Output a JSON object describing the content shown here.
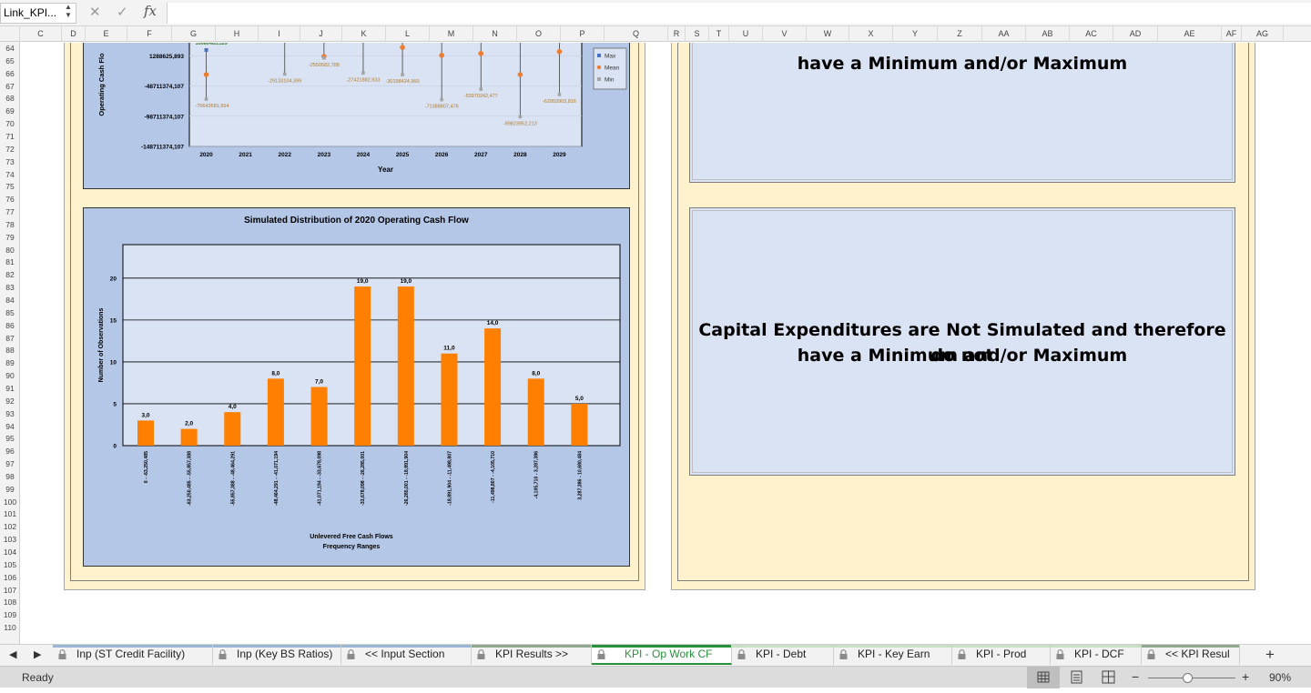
{
  "formula_bar": {
    "name_box": "Link_KPI...",
    "fx": "fx",
    "cancel_icon": "x-icon",
    "enter_icon": "check-icon",
    "formula": ""
  },
  "columns": [
    "C",
    "D",
    "E",
    "F",
    "G",
    "H",
    "I",
    "J",
    "K",
    "L",
    "M",
    "N",
    "O",
    "P",
    "Q",
    "R",
    "S",
    "T",
    "U",
    "V",
    "W",
    "X",
    "Y",
    "Z",
    "AA",
    "AB",
    "AC",
    "AD",
    "AE",
    "AF",
    "AG"
  ],
  "rows": [
    "64",
    "65",
    "66",
    "67",
    "68",
    "69",
    "70",
    "71",
    "72",
    "73",
    "74",
    "75",
    "76",
    "77",
    "78",
    "79",
    "80",
    "81",
    "82",
    "83",
    "84",
    "85",
    "86",
    "87",
    "88",
    "89",
    "90",
    "91",
    "92",
    "93",
    "94",
    "95",
    "96",
    "97",
    "98",
    "99",
    "100",
    "101",
    "102",
    "103",
    "104",
    "105",
    "106",
    "107",
    "108",
    "109",
    "110"
  ],
  "colors": {
    "panel": "#fff2cc",
    "chart_bg": "#b4c7e7",
    "plot_bg": "#dae3f3",
    "bar": "#ff7f00",
    "max_marker": "#4472c4",
    "mean_marker": "#ed7d31",
    "min_marker": "#a5a5a5",
    "active_tab": "#2a8f3a"
  },
  "chart_data": [
    {
      "type": "line",
      "title": "",
      "xlabel": "Year",
      "ylabel": "Operating Cash Flo",
      "categories": [
        "2020",
        "2021",
        "2022",
        "2023",
        "2024",
        "2025",
        "2026",
        "2027",
        "2028",
        "2029"
      ],
      "y_ticks": [
        "51288625,893",
        "1288625,893",
        "-48711374,107",
        "-98711374,107",
        "-148711374,107"
      ],
      "y_tick_values": [
        51288625.893,
        1288625.893,
        -48711374.107,
        -98711374.107,
        -148711374.107
      ],
      "partially_visible_tick": "3128862 3,893",
      "ylim": [
        -148711374.107,
        51288625.893
      ],
      "series": [
        {
          "name": "Max",
          "values": [
            10680483.129,
            51288625.893,
            51288625.893,
            51288625.893,
            51288625.893,
            51288625.893,
            51288625.893,
            51288625.893,
            51288625.893,
            51288625.893
          ]
        },
        {
          "name": "Mean",
          "values": [
            -30000000,
            51288625.893,
            51288625.893,
            0,
            51288625.893,
            15000000,
            2000000,
            5000000,
            -30000000,
            8000000
          ]
        },
        {
          "name": "Min",
          "values": [
            -70643581.654,
            37331075.935,
            -29133104.399,
            -2550582.788,
            -27421882.933,
            -30198424.96,
            -71388807.476,
            -53970242.477,
            -99823952.213,
            -62953903.816
          ]
        }
      ],
      "data_labels": {
        "max_2020": "10680483,129",
        "min": [
          "-70643581,654",
          "37331075,935",
          "-29133104,399",
          "-2550582,788",
          "-27421882,933",
          "-30198424,960",
          "-71388807,476",
          "-53970242,477",
          "-99823952,213",
          "-62953903,816"
        ]
      },
      "legend": [
        "Max",
        "Mean",
        "Min"
      ],
      "legend_position": "right"
    },
    {
      "type": "bar",
      "title": "Simulated Distribution of 2020 Operating Cash Flow",
      "xlabel_line1": "Unlevered Free Cash Flows",
      "xlabel_line2": "Frequency Ranges",
      "ylabel": "Number of Observations",
      "categories": [
        "0 - -63,250,485",
        "-63,250,485 - -55,857,388",
        "-55,857,388 - -48,464,291",
        "-48,464,291 - -41,071,194",
        "-41,071,194 - -33,678,098",
        "-33,678,098 - -26,285,001",
        "-26,285,001 - -18,891,904",
        "-18,891,904 - -11,498,807",
        "-11,498,807 - -4,105,710",
        "-4,105,710 - 3,287,386",
        "3,287,386 - 10,680,484"
      ],
      "values": [
        3,
        2,
        4,
        8,
        7,
        19,
        19,
        11,
        14,
        8,
        5
      ],
      "value_labels": [
        "3,0",
        "2,0",
        "4,0",
        "8,0",
        "7,0",
        "19,0",
        "19,0",
        "11,0",
        "14,0",
        "8,0",
        "5,0"
      ],
      "y_ticks": [
        "0",
        "5",
        "10",
        "15",
        "20"
      ],
      "ylim": [
        0,
        24
      ],
      "grid": true
    }
  ],
  "notes": {
    "top_line2": "have a Minimum and/or Maximum",
    "bottom_line1": "Capital Expenditures are Not Simulated and therefore do not",
    "bottom_line2": "have a Minimum and/or Maximum"
  },
  "tabs": [
    {
      "label": "Inp (ST Credit Facility)",
      "stripe": "#9bb5d4"
    },
    {
      "label": "Inp (Key BS Ratios)",
      "stripe": "#9bb5d4"
    },
    {
      "label": "<< Input Section",
      "stripe": "#9bb5d4"
    },
    {
      "label": "KPI Results >>",
      "stripe": "#8fa88f"
    },
    {
      "label": "KPI - Op Work CF",
      "stripe": "#2a8f3a",
      "active": true
    },
    {
      "label": "KPI - Debt",
      "stripe": "#c9dfc4"
    },
    {
      "label": "KPI - Key Earn",
      "stripe": "#c9dfc4"
    },
    {
      "label": "KPI - Prod",
      "stripe": "#c9dfc4"
    },
    {
      "label": "KPI - DCF",
      "stripe": "#c9dfc4"
    },
    {
      "label": "<< KPI Resul",
      "stripe": "#8fa88f"
    }
  ],
  "add_sheet_label": "+",
  "status": {
    "ready": "Ready",
    "zoom_minus": "−",
    "zoom_plus": "+",
    "zoom": "90%",
    "zoom_level": 0.9
  }
}
